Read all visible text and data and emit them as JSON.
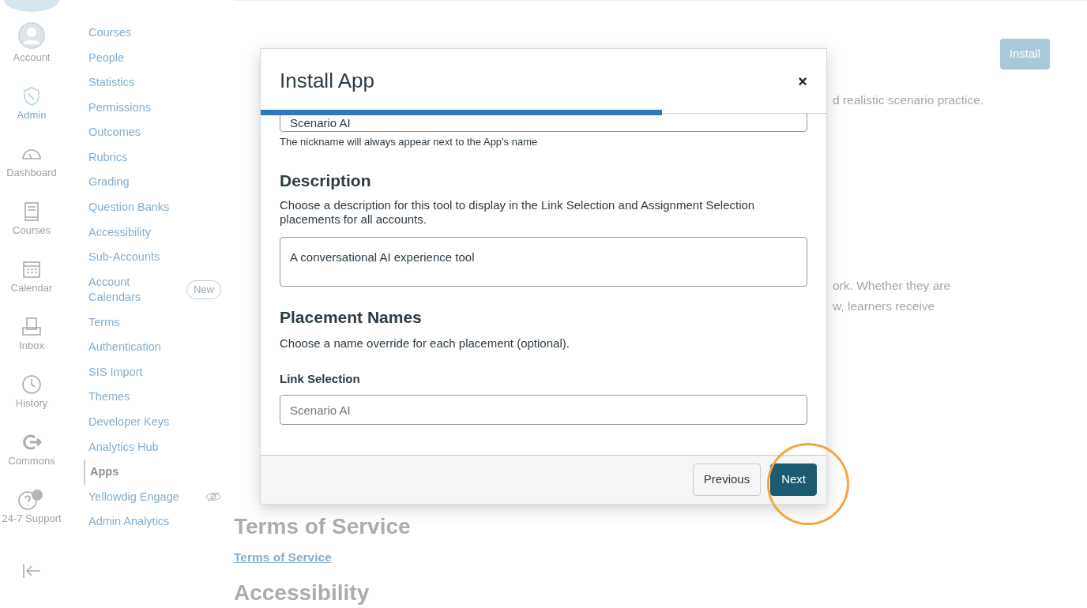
{
  "global_nav": [
    {
      "label": "Account",
      "selected": false
    },
    {
      "label": "Admin",
      "selected": true
    },
    {
      "label": "Dashboard",
      "selected": false
    },
    {
      "label": "Courses",
      "selected": false
    },
    {
      "label": "Calendar",
      "selected": false
    },
    {
      "label": "Inbox",
      "selected": false
    },
    {
      "label": "History",
      "selected": false
    },
    {
      "label": "Commons",
      "selected": false
    },
    {
      "label": "24-7 Support",
      "selected": false
    }
  ],
  "account_nav": [
    {
      "label": "Courses",
      "selected": false
    },
    {
      "label": "People",
      "selected": false
    },
    {
      "label": "Statistics",
      "selected": false
    },
    {
      "label": "Permissions",
      "selected": false
    },
    {
      "label": "Outcomes",
      "selected": false
    },
    {
      "label": "Rubrics",
      "selected": false
    },
    {
      "label": "Grading",
      "selected": false
    },
    {
      "label": "Question Banks",
      "selected": false
    },
    {
      "label": "Accessibility",
      "selected": false
    },
    {
      "label": "Sub-Accounts",
      "selected": false
    },
    {
      "label": "Account Calendars",
      "selected": false,
      "badge": "New"
    },
    {
      "label": "Terms",
      "selected": false
    },
    {
      "label": "Authentication",
      "selected": false
    },
    {
      "label": "SIS Import",
      "selected": false
    },
    {
      "label": "Themes",
      "selected": false
    },
    {
      "label": "Developer Keys",
      "selected": false
    },
    {
      "label": "Analytics Hub",
      "selected": false
    },
    {
      "label": "Apps",
      "selected": true
    },
    {
      "label": "Yellowdig Engage",
      "selected": false,
      "hidden_icon": true
    },
    {
      "label": "Admin Analytics",
      "selected": false
    }
  ],
  "page": {
    "install_button": "Install",
    "texts": [
      "d realistic scenario practice.",
      "ork. Whether they are",
      "w, learners receive"
    ],
    "terms_heading": "Terms of Service",
    "terms_link": "Terms of Service",
    "accessibility_heading": "Accessibility"
  },
  "modal": {
    "title": "Install App",
    "close": "×",
    "progress": {
      "level": 0.71
    },
    "nickname_value": "Scenario AI",
    "nickname_help": "The nickname will always appear next to the App's name",
    "description_heading": "Description",
    "description_text": "Choose a description for this tool to display in the Link Selection and Assignment Selection placements for all accounts.",
    "description_value": "A conversational AI experience tool",
    "placement_heading": "Placement Names",
    "placement_text": "Choose a name override for each placement (optional).",
    "link_selection_label": "Link Selection",
    "link_selection_placeholder": "Scenario AI",
    "buttons": [
      {
        "label": "Previous",
        "kind": "secondary",
        "highlighted": false
      },
      {
        "label": "Next",
        "kind": "primary",
        "highlighted": true
      }
    ]
  }
}
